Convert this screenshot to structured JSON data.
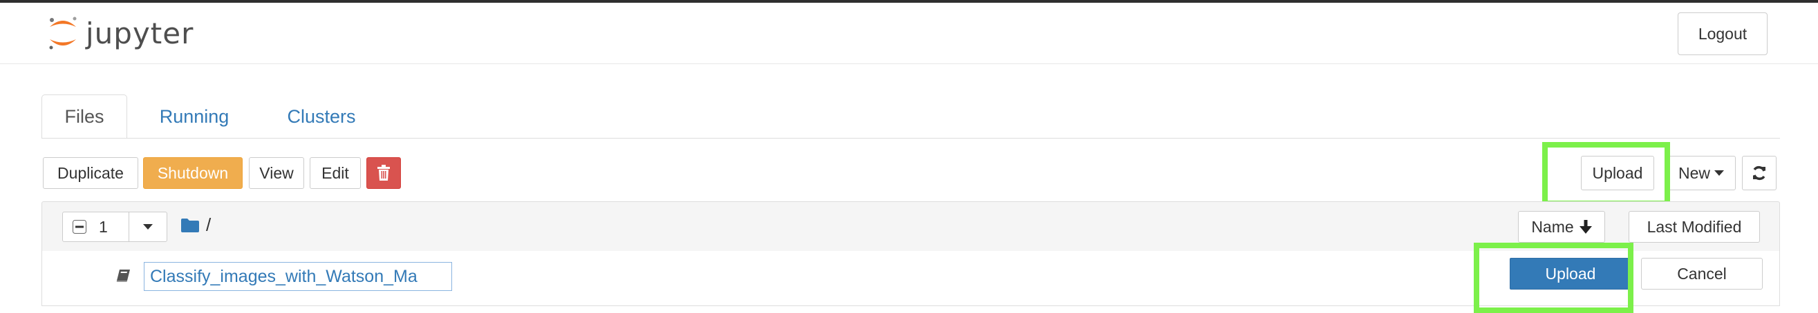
{
  "header": {
    "logo_text": "jupyter",
    "logout_label": "Logout"
  },
  "tabs": [
    {
      "label": "Files",
      "active": true
    },
    {
      "label": "Running",
      "active": false
    },
    {
      "label": "Clusters",
      "active": false
    }
  ],
  "toolbar": {
    "duplicate_label": "Duplicate",
    "shutdown_label": "Shutdown",
    "view_label": "View",
    "edit_label": "Edit",
    "delete_icon": "trash-icon",
    "upload_label": "Upload",
    "new_label": "New",
    "refresh_icon": "refresh-icon"
  },
  "file_list": {
    "selected_count": "1",
    "breadcrumb": "/",
    "sort_name_label": "Name",
    "sort_modified_label": "Last Modified",
    "rows": [
      {
        "icon": "notebook-icon",
        "filename_value": "Classify_images_with_Watson_Ma",
        "upload_label": "Upload",
        "cancel_label": "Cancel"
      }
    ]
  },
  "colors": {
    "link": "#337ab7",
    "warning": "#f0ad4e",
    "danger": "#d9534f",
    "primary": "#337ab7",
    "highlight": "#7cf04a",
    "logo_orange": "#f37726"
  }
}
